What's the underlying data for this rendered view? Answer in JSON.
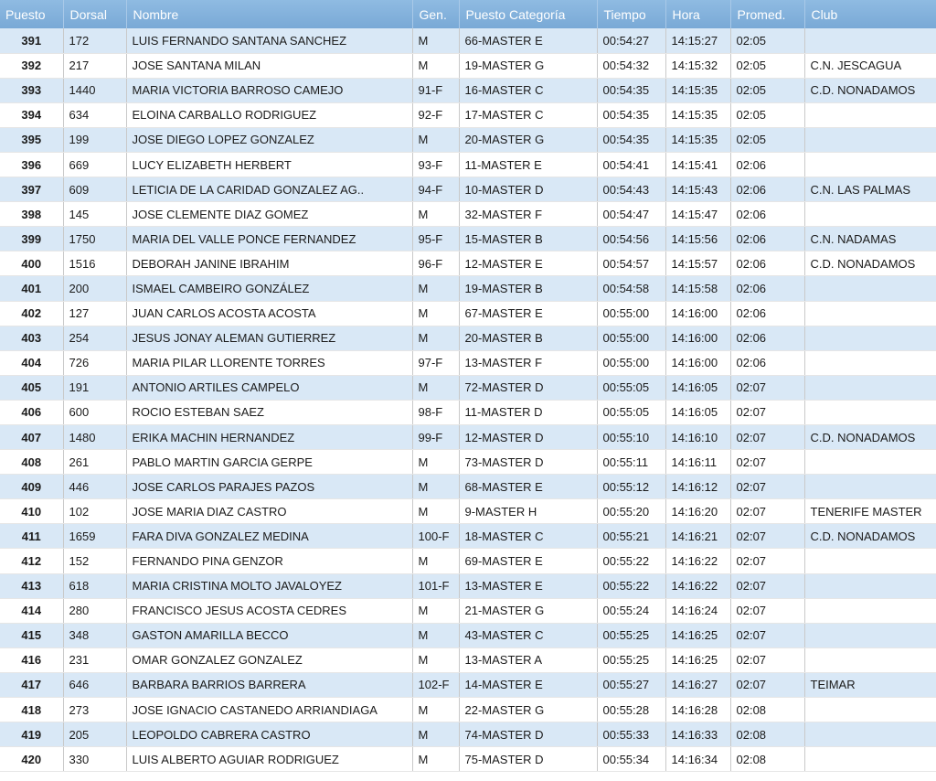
{
  "table": {
    "columns": [
      "Puesto",
      "Dorsal",
      "Nombre",
      "Gen.",
      "Puesto Categoría",
      "Tiempo",
      "Hora",
      "Promed.",
      "Club"
    ],
    "rows": [
      [
        "391",
        "172",
        "LUIS FERNANDO SANTANA SANCHEZ",
        "M",
        "66-MASTER E",
        "00:54:27",
        "14:15:27",
        "02:05",
        ""
      ],
      [
        "392",
        "217",
        "JOSE SANTANA MILAN",
        "M",
        "19-MASTER G",
        "00:54:32",
        "14:15:32",
        "02:05",
        "C.N. JESCAGUA"
      ],
      [
        "393",
        "1440",
        "MARIA VICTORIA BARROSO CAMEJO",
        "91-F",
        "16-MASTER C",
        "00:54:35",
        "14:15:35",
        "02:05",
        "C.D. NONADAMOS"
      ],
      [
        "394",
        "634",
        "ELOINA CARBALLO RODRIGUEZ",
        "92-F",
        "17-MASTER C",
        "00:54:35",
        "14:15:35",
        "02:05",
        ""
      ],
      [
        "395",
        "199",
        "JOSE DIEGO LOPEZ GONZALEZ",
        "M",
        "20-MASTER G",
        "00:54:35",
        "14:15:35",
        "02:05",
        ""
      ],
      [
        "396",
        "669",
        "LUCY ELIZABETH HERBERT",
        "93-F",
        "11-MASTER E",
        "00:54:41",
        "14:15:41",
        "02:06",
        ""
      ],
      [
        "397",
        "609",
        "LETICIA DE LA CARIDAD GONZALEZ AG..",
        "94-F",
        "10-MASTER D",
        "00:54:43",
        "14:15:43",
        "02:06",
        "C.N. LAS PALMAS"
      ],
      [
        "398",
        "145",
        "JOSE CLEMENTE DIAZ GOMEZ",
        "M",
        "32-MASTER F",
        "00:54:47",
        "14:15:47",
        "02:06",
        ""
      ],
      [
        "399",
        "1750",
        "MARIA DEL VALLE PONCE FERNANDEZ",
        "95-F",
        "15-MASTER B",
        "00:54:56",
        "14:15:56",
        "02:06",
        "C.N. NADAMAS"
      ],
      [
        "400",
        "1516",
        "DEBORAH JANINE IBRAHIM",
        "96-F",
        "12-MASTER E",
        "00:54:57",
        "14:15:57",
        "02:06",
        "C.D. NONADAMOS"
      ],
      [
        "401",
        "200",
        "ISMAEL CAMBEIRO GONZÁLEZ",
        "M",
        "19-MASTER B",
        "00:54:58",
        "14:15:58",
        "02:06",
        ""
      ],
      [
        "402",
        "127",
        "JUAN CARLOS ACOSTA ACOSTA",
        "M",
        "67-MASTER E",
        "00:55:00",
        "14:16:00",
        "02:06",
        ""
      ],
      [
        "403",
        "254",
        "JESUS JONAY ALEMAN GUTIERREZ",
        "M",
        "20-MASTER B",
        "00:55:00",
        "14:16:00",
        "02:06",
        ""
      ],
      [
        "404",
        "726",
        "MARIA PILAR LLORENTE TORRES",
        "97-F",
        "13-MASTER F",
        "00:55:00",
        "14:16:00",
        "02:06",
        ""
      ],
      [
        "405",
        "191",
        "ANTONIO ARTILES CAMPELO",
        "M",
        "72-MASTER D",
        "00:55:05",
        "14:16:05",
        "02:07",
        ""
      ],
      [
        "406",
        "600",
        "ROCIO ESTEBAN SAEZ",
        "98-F",
        "11-MASTER D",
        "00:55:05",
        "14:16:05",
        "02:07",
        ""
      ],
      [
        "407",
        "1480",
        "ERIKA MACHIN HERNANDEZ",
        "99-F",
        "12-MASTER D",
        "00:55:10",
        "14:16:10",
        "02:07",
        "C.D. NONADAMOS"
      ],
      [
        "408",
        "261",
        "PABLO MARTIN GARCIA GERPE",
        "M",
        "73-MASTER D",
        "00:55:11",
        "14:16:11",
        "02:07",
        ""
      ],
      [
        "409",
        "446",
        "JOSE CARLOS PARAJES PAZOS",
        "M",
        "68-MASTER E",
        "00:55:12",
        "14:16:12",
        "02:07",
        ""
      ],
      [
        "410",
        "102",
        "JOSE MARIA DIAZ CASTRO",
        "M",
        "9-MASTER H",
        "00:55:20",
        "14:16:20",
        "02:07",
        "TENERIFE MASTER"
      ],
      [
        "411",
        "1659",
        "FARA DIVA GONZALEZ MEDINA",
        "100-F",
        "18-MASTER C",
        "00:55:21",
        "14:16:21",
        "02:07",
        "C.D. NONADAMOS"
      ],
      [
        "412",
        "152",
        "FERNANDO PINA GENZOR",
        "M",
        "69-MASTER E",
        "00:55:22",
        "14:16:22",
        "02:07",
        ""
      ],
      [
        "413",
        "618",
        "MARIA CRISTINA MOLTO JAVALOYEZ",
        "101-F",
        "13-MASTER E",
        "00:55:22",
        "14:16:22",
        "02:07",
        ""
      ],
      [
        "414",
        "280",
        "FRANCISCO JESUS ACOSTA CEDRES",
        "M",
        "21-MASTER G",
        "00:55:24",
        "14:16:24",
        "02:07",
        ""
      ],
      [
        "415",
        "348",
        "GASTON AMARILLA BECCO",
        "M",
        "43-MASTER C",
        "00:55:25",
        "14:16:25",
        "02:07",
        ""
      ],
      [
        "416",
        "231",
        "OMAR GONZALEZ GONZALEZ",
        "M",
        "13-MASTER A",
        "00:55:25",
        "14:16:25",
        "02:07",
        ""
      ],
      [
        "417",
        "646",
        "BARBARA BARRIOS BARRERA",
        "102-F",
        "14-MASTER E",
        "00:55:27",
        "14:16:27",
        "02:07",
        "TEIMAR"
      ],
      [
        "418",
        "273",
        "JOSE IGNACIO CASTANEDO ARRIANDIAGA",
        "M",
        "22-MASTER G",
        "00:55:28",
        "14:16:28",
        "02:08",
        ""
      ],
      [
        "419",
        "205",
        "LEOPOLDO CABRERA CASTRO",
        "M",
        "74-MASTER D",
        "00:55:33",
        "14:16:33",
        "02:08",
        ""
      ],
      [
        "420",
        "330",
        "LUIS ALBERTO AGUIAR RODRIGUEZ",
        "M",
        "75-MASTER D",
        "00:55:34",
        "14:16:34",
        "02:08",
        ""
      ]
    ]
  },
  "colors": {
    "header_bg": "#80aedb",
    "row_alt_bg": "#d9e8f6",
    "row_bg": "#ffffff"
  }
}
